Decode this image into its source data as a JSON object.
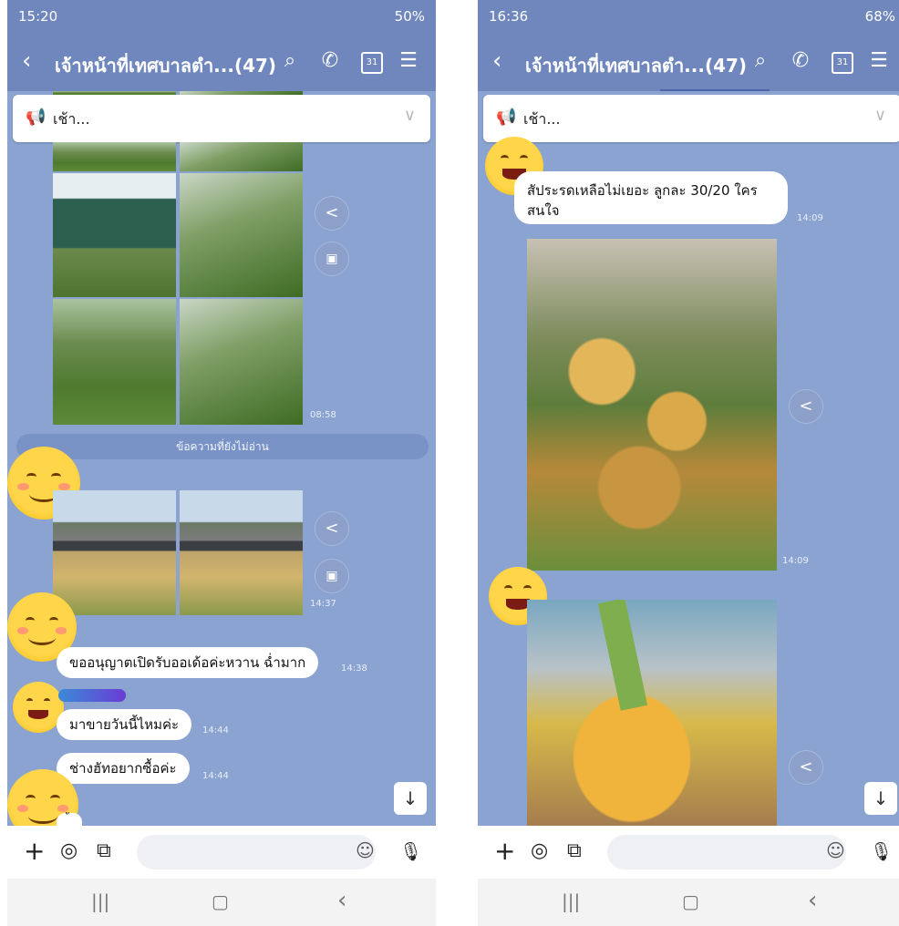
{
  "left": {
    "status": {
      "time": "15:20",
      "right": "50%"
    },
    "header": {
      "title": "เจ้าหน้าที่เทศบาลตำ...(47)"
    },
    "announcement": {
      "text": "เช้า..."
    },
    "unread_label": "ข้อความที่ยังไม่อ่าน",
    "times": {
      "photos1": "08:58",
      "photos2": "14:37",
      "msg1": "14:38",
      "msg2": "14:44",
      "msg3": "14:44"
    },
    "messages": {
      "msg1": "ขออนุญาตเปิดรับออเด้อค่ะหวาน ฉ่ำมาก",
      "msg2": "มาขายวันนี้ไหมค่ะ",
      "msg3": "ช่างฮัทอยากซื้อค่ะ",
      "msg4": "ั"
    }
  },
  "right": {
    "status": {
      "time": "16:36",
      "right": "68%"
    },
    "header": {
      "title": "เจ้าหน้าที่เทศบาลตำ...(47)"
    },
    "announcement": {
      "text": "เช้า..."
    },
    "times": {
      "msg1": "14:09",
      "photo1": "14:09"
    },
    "messages": {
      "msg1": "สัประรดเหลือไม่เยอะ ลูกละ 30/20 ใครสนใจ"
    }
  },
  "icons": {
    "back": "‹",
    "search": "⌕",
    "call": "✆",
    "calendar": "31",
    "menu": "☰",
    "share": "<",
    "add": "+",
    "camera": "◎",
    "image": "⧉",
    "emoji": "☺",
    "mic": "🎙",
    "scroll_down": "↓",
    "megaphone": "📢",
    "chevron_down": "∨",
    "nav_recent": "|||",
    "nav_home": "▢",
    "nav_back": "‹",
    "keep": "▣"
  }
}
